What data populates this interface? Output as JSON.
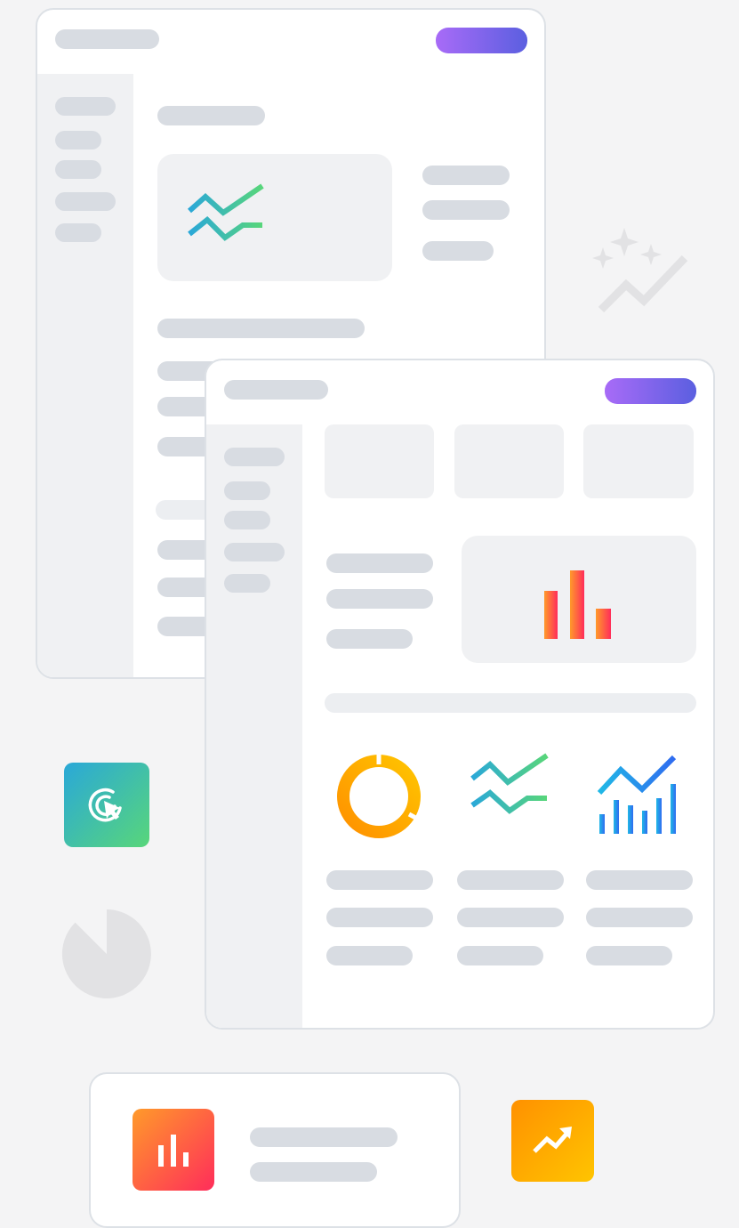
{
  "colors": {
    "background": "#f4f4f5",
    "card": "#ffffff",
    "card_border": "#dde1e6",
    "placeholder_bar": "#d8dce2",
    "panel": "#f0f1f3",
    "accent_gradient": [
      "#a86bf7",
      "#5b5fe0"
    ],
    "teal_green_gradient": [
      "#2aa8d8",
      "#58d67a"
    ],
    "orange_red_gradient": [
      "#ff9a2a",
      "#ff2d5a"
    ],
    "amber_gradient": [
      "#ff9100",
      "#ffc400"
    ],
    "blue_gradient": [
      "#20b8e6",
      "#2f6cf0"
    ],
    "decor_gray": "#e2e2e4"
  },
  "back_window": {
    "primary_action": {
      "icon": "accent-pill"
    },
    "chart_panel": {
      "icon": "line-chart-icon"
    }
  },
  "front_window": {
    "primary_action": {
      "icon": "accent-pill"
    },
    "chart_panel": {
      "icon": "bar-chart-icon"
    },
    "widgets": [
      {
        "icon": "donut-chart-icon"
      },
      {
        "icon": "line-chart-icon"
      },
      {
        "icon": "trend-bar-chart-icon"
      }
    ]
  },
  "floating_tiles": [
    {
      "icon": "click-target-icon"
    },
    {
      "icon": "bar-chart-icon"
    },
    {
      "icon": "trend-up-icon"
    }
  ],
  "decorations": [
    {
      "icon": "sparkle-trend-icon"
    },
    {
      "icon": "pie-chart-icon"
    }
  ]
}
